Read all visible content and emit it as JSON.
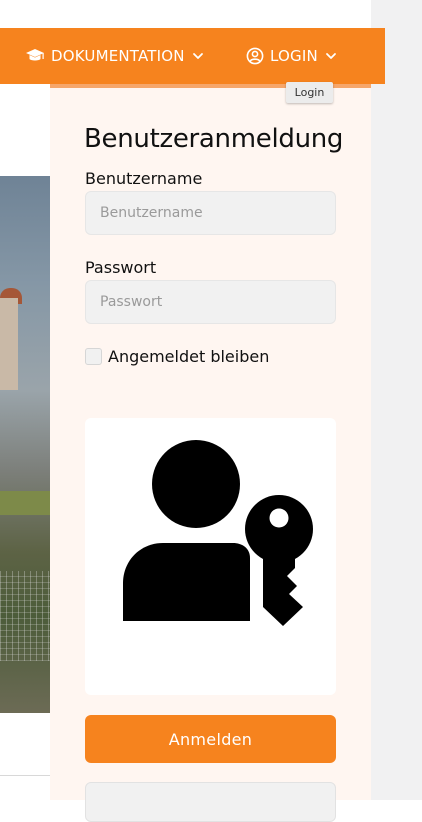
{
  "navbar": {
    "doc_label": "DOKUMENTATION",
    "login_label": "LOGIN",
    "login_tooltip": "Login",
    "accent_color": "#f6831e"
  },
  "login": {
    "title": "Benutzeranmeldung",
    "username_label": "Benutzername",
    "username_placeholder": "Benutzername",
    "password_label": "Passwort",
    "password_placeholder": "Passwort",
    "remember_label": "Angemeldet bleiben",
    "remember_checked": false,
    "submit_label": "Anmelden",
    "illustration_icon": "user-key-icon"
  }
}
